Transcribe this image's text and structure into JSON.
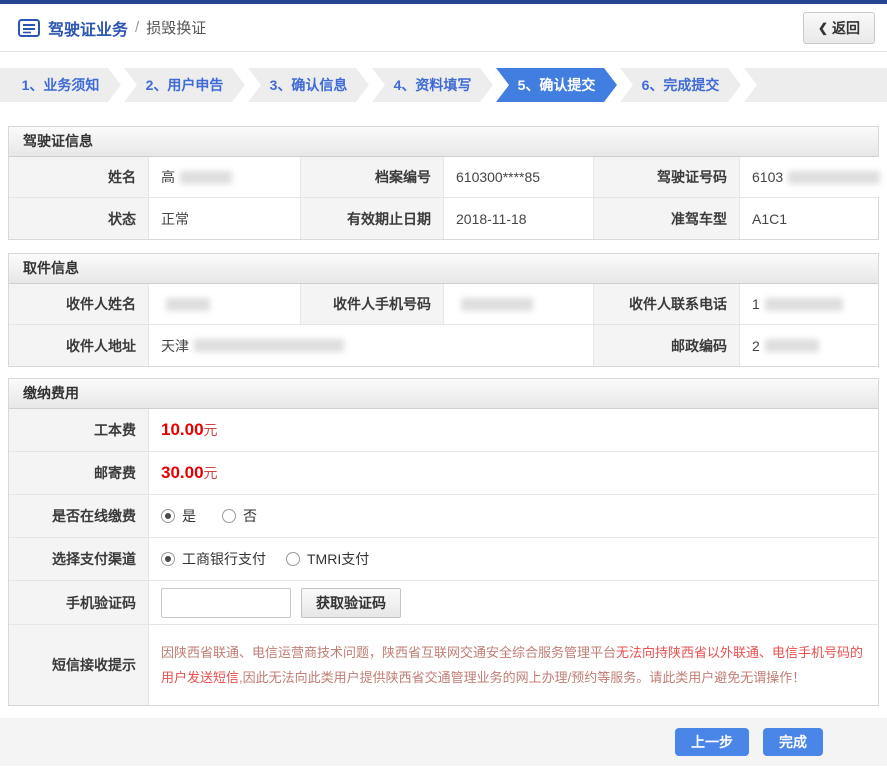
{
  "header": {
    "title": "驾驶证业务",
    "separator": "/",
    "subtitle": "损毁换证",
    "back_chevron": "❮",
    "back_label": "返回"
  },
  "steps": [
    {
      "label": "1、业务须知",
      "active": false
    },
    {
      "label": "2、用户申告",
      "active": false
    },
    {
      "label": "3、确认信息",
      "active": false
    },
    {
      "label": "4、资料填写",
      "active": false
    },
    {
      "label": "5、确认提交",
      "active": true
    },
    {
      "label": "6、完成提交",
      "active": false
    }
  ],
  "sections": {
    "license": {
      "title": "驾驶证信息",
      "rows": [
        [
          {
            "label": "姓名",
            "value": "高"
          },
          {
            "label": "档案编号",
            "value": "610300****85"
          },
          {
            "label": "驾驶证号码",
            "value": "6103"
          }
        ],
        [
          {
            "label": "状态",
            "value": "正常"
          },
          {
            "label": "有效期止日期",
            "value": "2018-11-18"
          },
          {
            "label": "准驾车型",
            "value": "A1C1"
          }
        ]
      ]
    },
    "pickup": {
      "title": "取件信息",
      "rows": [
        [
          {
            "label": "收件人姓名",
            "value": ""
          },
          {
            "label": "收件人手机号码",
            "value": ""
          },
          {
            "label": "收件人联系电话",
            "value": "1"
          }
        ],
        [
          {
            "label": "收件人地址",
            "value": "天津"
          },
          {
            "label": "邮政编码",
            "value": "2"
          }
        ]
      ]
    },
    "payment": {
      "title": "缴纳费用",
      "fees": [
        {
          "label": "工本费",
          "amount": "10.00",
          "unit": "元"
        },
        {
          "label": "邮寄费",
          "amount": "30.00",
          "unit": "元"
        }
      ],
      "online_pay": {
        "label": "是否在线缴费",
        "options": [
          {
            "label": "是",
            "selected": true
          },
          {
            "label": "否",
            "selected": false
          }
        ]
      },
      "channel": {
        "label": "选择支付渠道",
        "options": [
          {
            "label": "工商银行支付",
            "selected": true
          },
          {
            "label": "TMRI支付",
            "selected": false
          }
        ]
      },
      "sms_code": {
        "label": "手机验证码",
        "input_value": "",
        "input_placeholder": "",
        "button_label": "获取验证码"
      },
      "sms_notice": {
        "label": "短信接收提示",
        "text_part1": "因陕西省联通、电信运营商技术问题，陕西省互联网交通安全综合服务管理平台",
        "text_emphasis": "无法向持陕西省以外联通、电信手机号码的用户发送短信",
        "text_part2": ",因此无法向此类用户提供陕西省交通管理业务的网上办理/预约等服务。请此类用户避免无谓操作！"
      }
    }
  },
  "footer": {
    "prev_label": "上一步",
    "finish_label": "完成"
  },
  "colors": {
    "topbar_navy": "#25458f",
    "title_blue": "#2b55b2",
    "step_active_blue": "#417ee0",
    "step_inactive_bg": "#ededed",
    "step_text_blue": "#3f6bd6",
    "label_cell_bg": "#f4f4f4",
    "fee_red": "#e60000",
    "notice_base": "#c07d74",
    "notice_emphasis": "#e85050",
    "action_button_blue": "#4a86e8"
  }
}
